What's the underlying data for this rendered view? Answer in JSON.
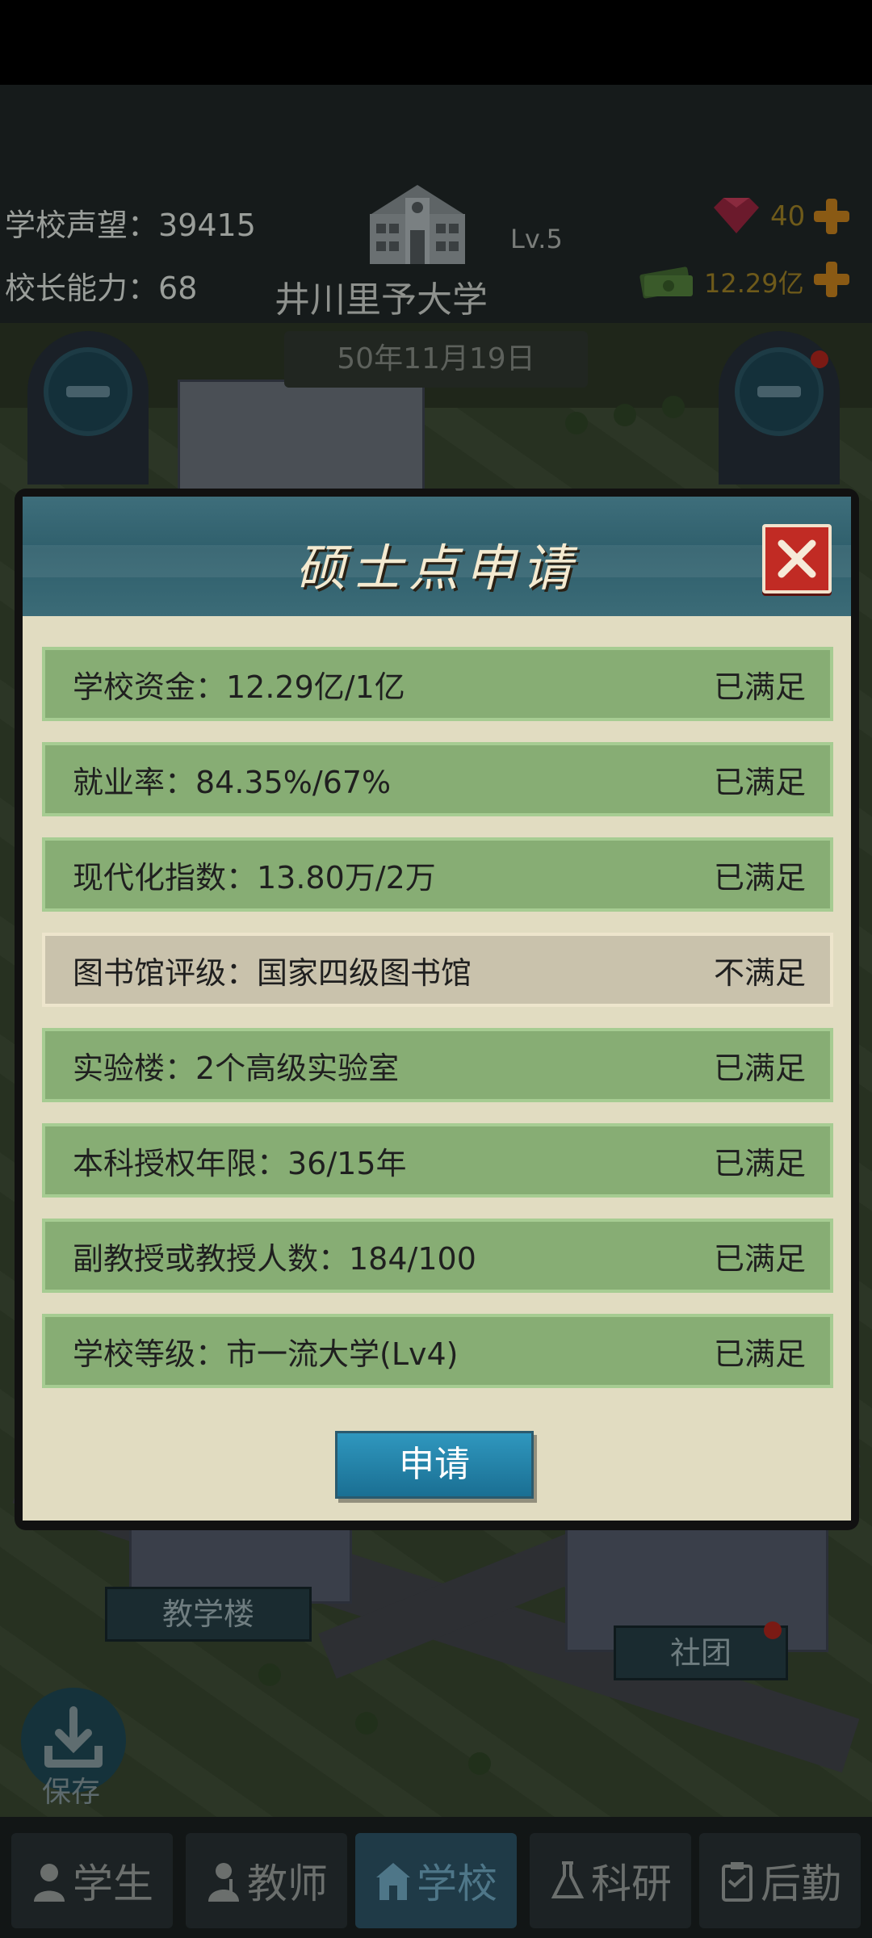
{
  "hud": {
    "reputation_label": "学校声望：",
    "reputation_value": "39415",
    "principal_label": "校长能力：",
    "principal_value": "68",
    "school_name": "井川里予大学",
    "school_level": "Lv.5",
    "date": "50年11月19日",
    "gems": "40",
    "money": "12.29亿"
  },
  "map": {
    "label_teaching": "教学楼",
    "label_club": "社团",
    "save_label": "保存"
  },
  "dialog": {
    "title": "硕士点申请",
    "rows": [
      {
        "text": "学校资金：12.29亿/1亿",
        "status": "已满足",
        "met": true
      },
      {
        "text": "就业率：84.35%/67%",
        "status": "已满足",
        "met": true
      },
      {
        "text": "现代化指数：13.80万/2万",
        "status": "已满足",
        "met": true
      },
      {
        "text": "图书馆评级：国家四级图书馆",
        "status": "不满足",
        "met": false
      },
      {
        "text": "实验楼：2个高级实验室",
        "status": "已满足",
        "met": true
      },
      {
        "text": "本科授权年限：36/15年",
        "status": "已满足",
        "met": true
      },
      {
        "text": "副教授或教授人数：184/100",
        "status": "已满足",
        "met": true
      },
      {
        "text": "学校等级：市一流大学(Lv4)",
        "status": "已满足",
        "met": true
      }
    ],
    "apply_label": "申请"
  },
  "nav": {
    "items": [
      {
        "label": "学生",
        "icon": "student-icon"
      },
      {
        "label": "教师",
        "icon": "teacher-icon"
      },
      {
        "label": "学校",
        "icon": "school-icon",
        "active": true
      },
      {
        "label": "科研",
        "icon": "flask-icon"
      },
      {
        "label": "后勤",
        "icon": "clipboard-icon"
      }
    ]
  },
  "colors": {
    "row_met": "#87ad74",
    "row_unmet": "#c9c2ac",
    "close_red": "#c12b24",
    "apply_blue": "#1f7fa6"
  }
}
